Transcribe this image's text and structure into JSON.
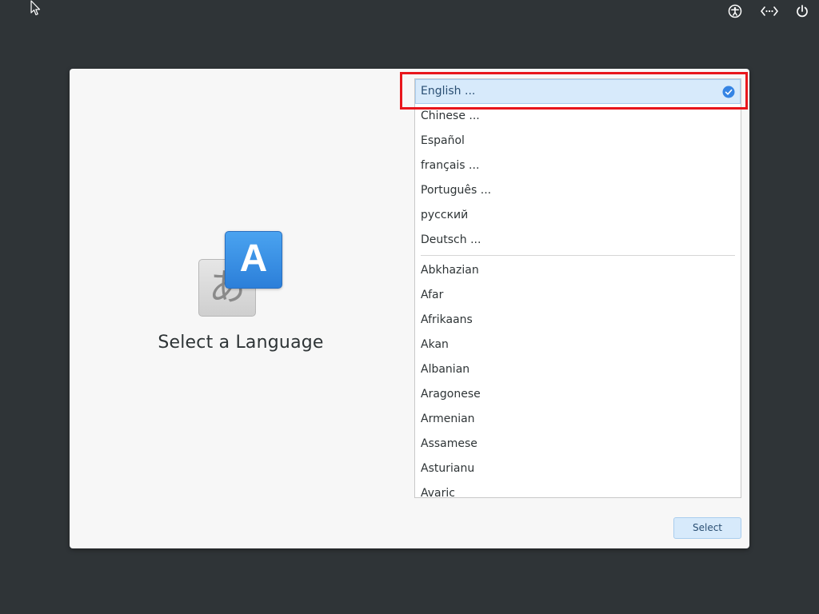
{
  "system_tray": {
    "accessibility_icon": "accessibility-icon",
    "network_icon": "network-icon",
    "power_icon": "power-icon"
  },
  "dialog": {
    "title": "Select a Language",
    "illustration": {
      "back_glyph": "あ",
      "front_glyph": "A"
    },
    "languages": {
      "featured": [
        {
          "label": "English ...",
          "selected": true
        },
        {
          "label": "Chinese ...",
          "selected": false
        },
        {
          "label": "Español",
          "selected": false
        },
        {
          "label": "français ...",
          "selected": false
        },
        {
          "label": "Português ...",
          "selected": false
        },
        {
          "label": "русский",
          "selected": false
        },
        {
          "label": "Deutsch ...",
          "selected": false
        }
      ],
      "all": [
        "Abkhazian",
        "Afar",
        "Afrikaans",
        "Akan",
        "Albanian",
        "Aragonese",
        "Armenian",
        "Assamese",
        "Asturianu",
        "Avaric"
      ]
    },
    "select_button_label": "Select"
  },
  "colors": {
    "background": "#2f3437",
    "selection": "#d7eafb",
    "highlight_annotation": "#e8161c",
    "accent": "#3584e4"
  }
}
